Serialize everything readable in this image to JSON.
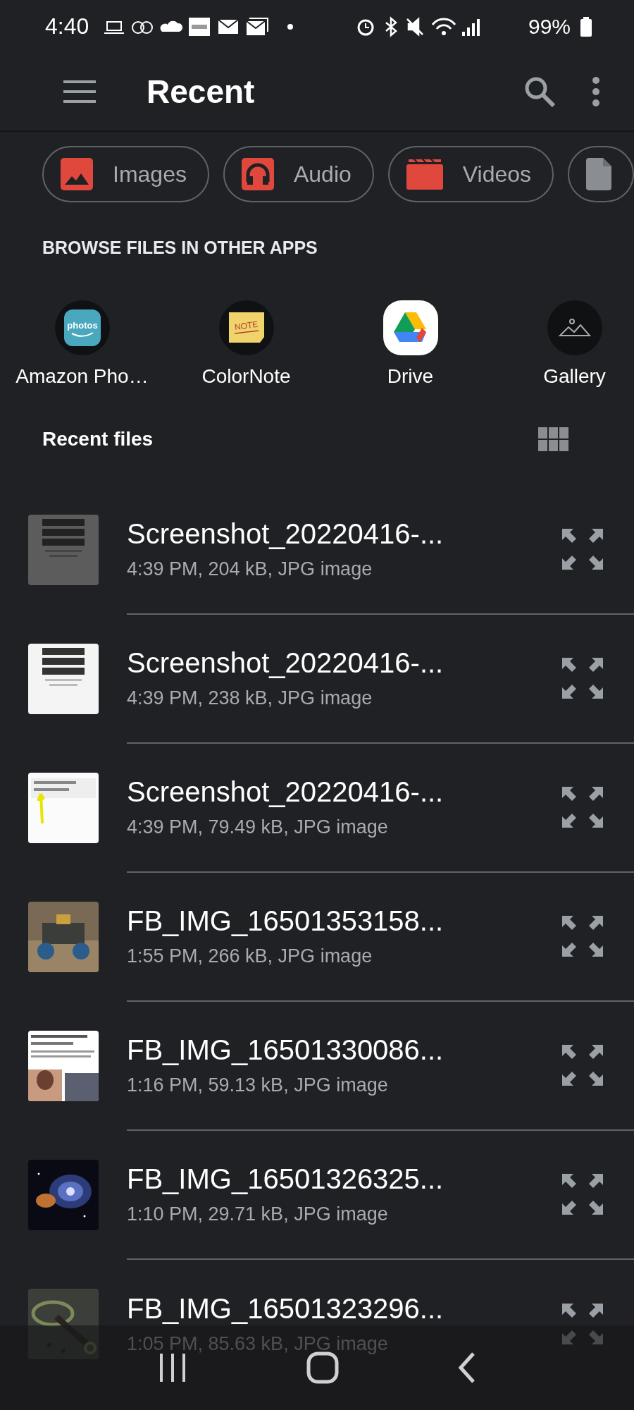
{
  "status_bar": {
    "time": "4:40",
    "battery": "99%"
  },
  "toolbar": {
    "title": "Recent"
  },
  "categories": [
    {
      "kind": "images",
      "label": "Images"
    },
    {
      "kind": "audio",
      "label": "Audio"
    },
    {
      "kind": "videos",
      "label": "Videos"
    },
    {
      "kind": "documents"
    }
  ],
  "browse_title": "BROWSE FILES IN OTHER APPS",
  "apps": [
    {
      "kind": "amazon",
      "label": "Amazon Pho…",
      "logo_text": "photos"
    },
    {
      "kind": "colornote",
      "label": "ColorNote",
      "logo_text": "NOTE"
    },
    {
      "kind": "drive",
      "label": "Drive"
    },
    {
      "kind": "gallery",
      "label": "Gallery"
    }
  ],
  "recent_title": "Recent files",
  "files": [
    {
      "name": "Screenshot_20220416-...",
      "details": "4:39 PM, 204 kB, JPG image"
    },
    {
      "name": "Screenshot_20220416-...",
      "details": "4:39 PM, 238 kB, JPG image"
    },
    {
      "name": "Screenshot_20220416-...",
      "details": "4:39 PM, 79.49 kB, JPG image"
    },
    {
      "name": "FB_IMG_16501353158...",
      "details": "1:55 PM, 266 kB, JPG image"
    },
    {
      "name": "FB_IMG_16501330086...",
      "details": "1:16 PM, 59.13 kB, JPG image"
    },
    {
      "name": "FB_IMG_16501326325...",
      "details": "1:10 PM, 29.71 kB, JPG image"
    },
    {
      "name": "FB_IMG_16501323296...",
      "details": "1:05 PM, 85.63 kB, JPG image"
    }
  ]
}
